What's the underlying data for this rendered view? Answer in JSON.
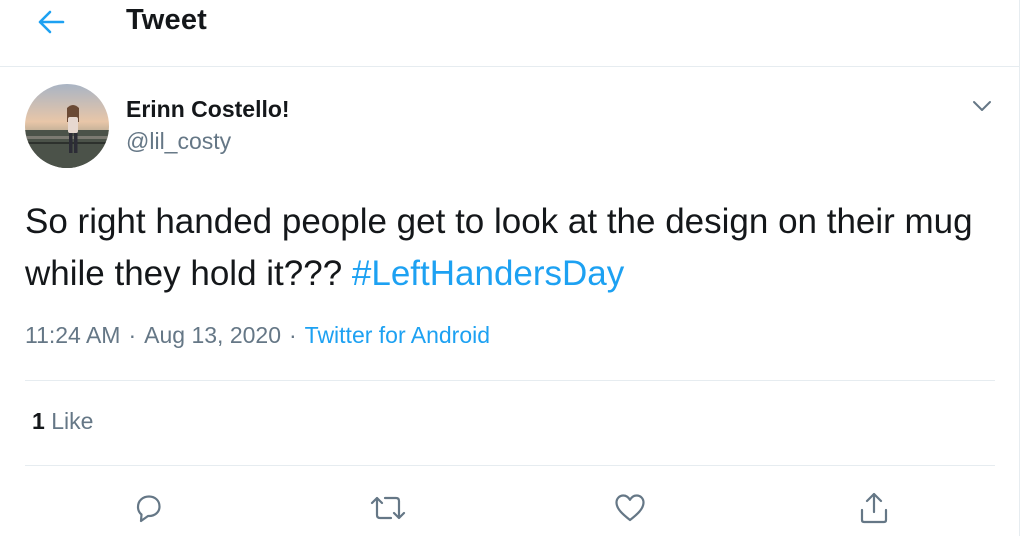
{
  "header": {
    "title": "Tweet",
    "back_icon": "arrow-left-icon"
  },
  "author": {
    "display_name": "Erinn Costello!",
    "handle": "@lil_costy"
  },
  "tweet": {
    "text": "So right handed people get to look at the design on their mug while they hold it???",
    "hashtag": "#LeftHandersDay",
    "time": "11:24 AM",
    "date": "Aug 13, 2020",
    "source": "Twitter for Android",
    "separator": "·"
  },
  "stats": {
    "like_count": "1",
    "like_label": "Like"
  },
  "actions": [
    "reply-icon",
    "retweet-icon",
    "like-icon",
    "share-icon"
  ],
  "colors": {
    "accent": "#1da1f2",
    "text": "#14171a",
    "secondary": "#657786",
    "border": "#e6ecf0"
  }
}
